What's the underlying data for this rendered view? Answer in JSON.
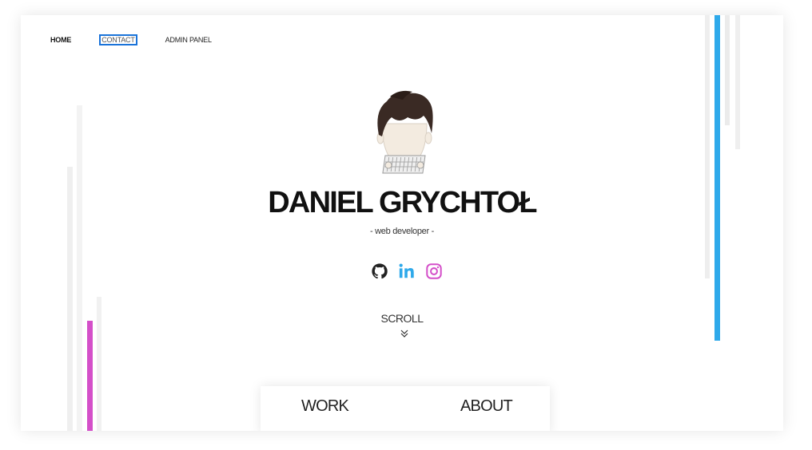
{
  "nav": {
    "items": [
      {
        "label": "HOME",
        "state": "active"
      },
      {
        "label": "CONTACT",
        "state": "focused"
      },
      {
        "label": "ADMIN PANEL",
        "state": "normal"
      }
    ]
  },
  "hero": {
    "name": "DANIEL GRYCHTOŁ",
    "subtitle": "- web developer -",
    "avatar_icon": "avatar-illustration"
  },
  "socials": [
    {
      "icon": "github-icon",
      "color": "#222222"
    },
    {
      "icon": "linkedin-icon",
      "color": "#2ea9ea"
    },
    {
      "icon": "instagram-icon",
      "color": "#d44fc9"
    }
  ],
  "scroll": {
    "label": "SCROLL",
    "icon": "double-chevron-down-icon"
  },
  "tabs": [
    {
      "label": "WORK"
    },
    {
      "label": "ABOUT"
    }
  ],
  "colors": {
    "accent_blue": "#2ea9ea",
    "accent_pink": "#d44fc9",
    "focus_outline": "#1a73d9"
  }
}
